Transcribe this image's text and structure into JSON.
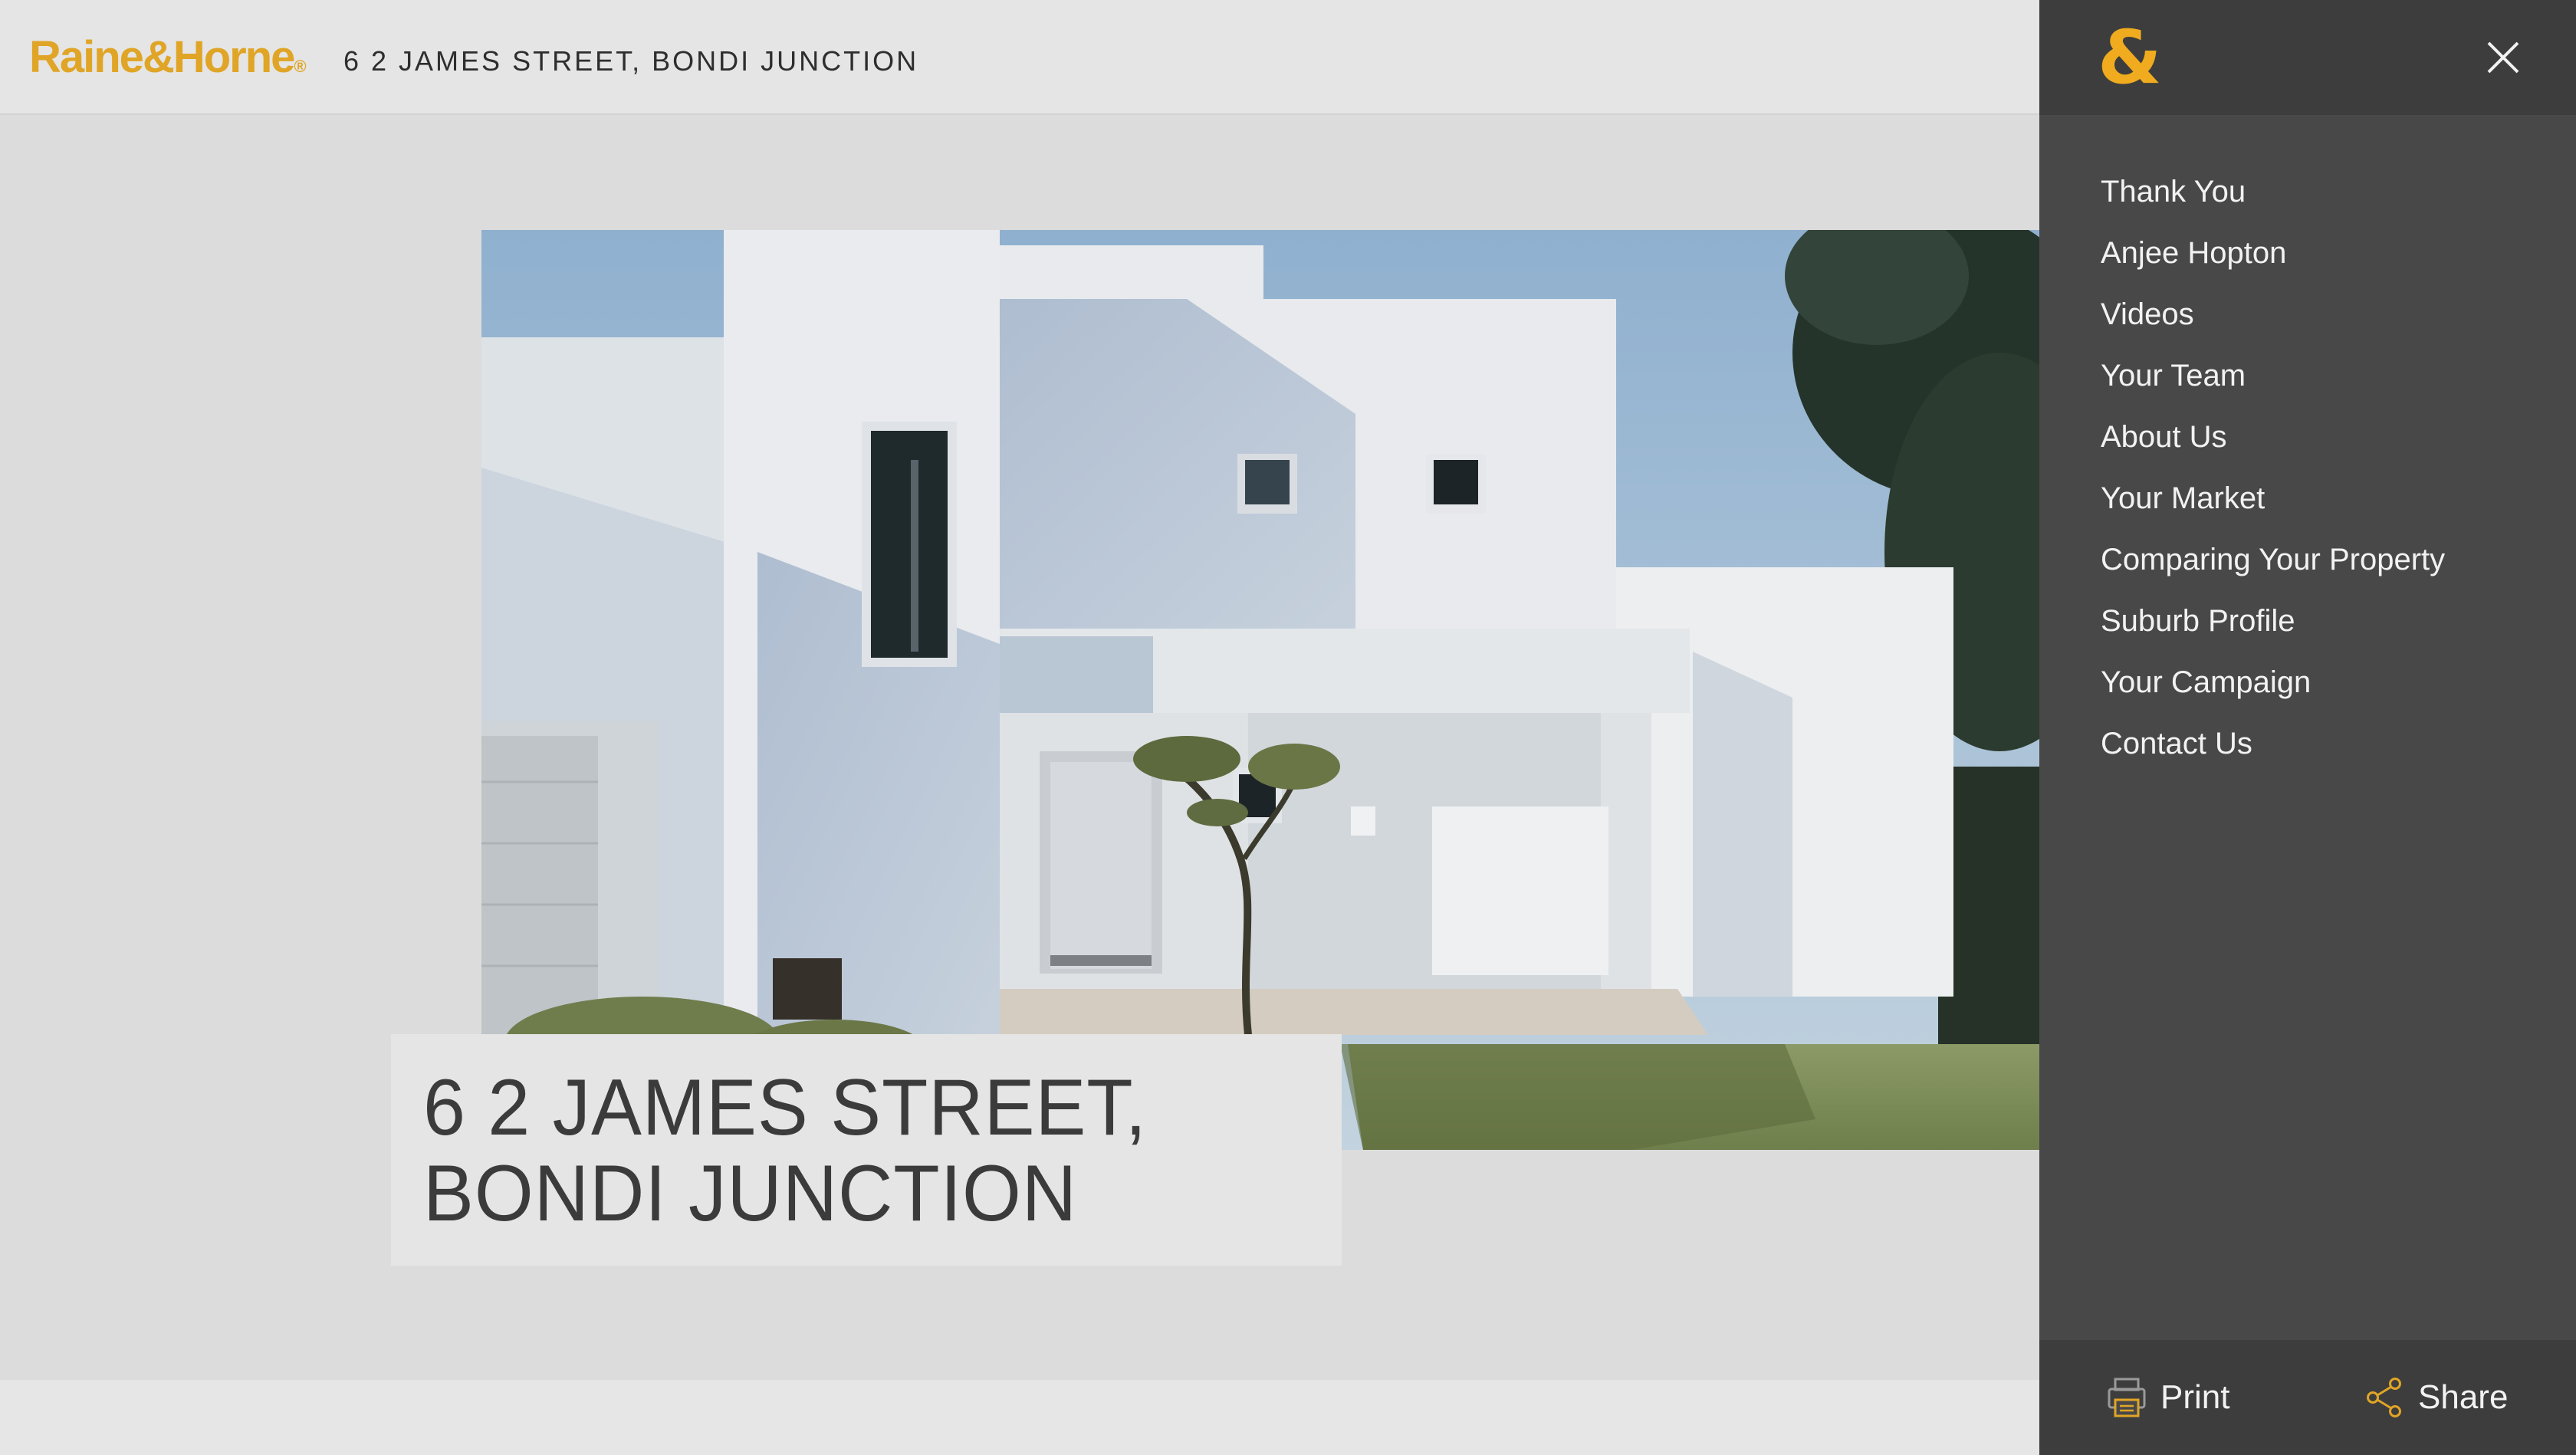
{
  "header": {
    "logo_text": "Raine&Horne",
    "logo_mark": "®",
    "address": "6 2 JAMES STREET, BONDI JUNCTION"
  },
  "hero": {
    "image": "modern-white-house-photo",
    "title_line1": "6 2 JAMES STREET,",
    "title_line2": "BONDI JUNCTION"
  },
  "menu": {
    "brand_mark": "&",
    "close_icon": "close-icon",
    "items": [
      {
        "label": "Thank You"
      },
      {
        "label": "Anjee Hopton"
      },
      {
        "label": "Videos"
      },
      {
        "label": "Your Team"
      },
      {
        "label": "About Us"
      },
      {
        "label": "Your Market"
      },
      {
        "label": "Comparing Your Property"
      },
      {
        "label": "Suburb Profile"
      },
      {
        "label": "Your Campaign"
      },
      {
        "label": "Contact Us"
      }
    ],
    "footer": {
      "print_label": "Print",
      "share_label": "Share",
      "print_icon": "printer-icon",
      "share_icon": "share-icon"
    }
  },
  "colors": {
    "brand": "#e0a526",
    "menu_bg": "#484848",
    "menu_bar_bg": "#3d3d3d",
    "page_bg": "#dcdcdc"
  }
}
